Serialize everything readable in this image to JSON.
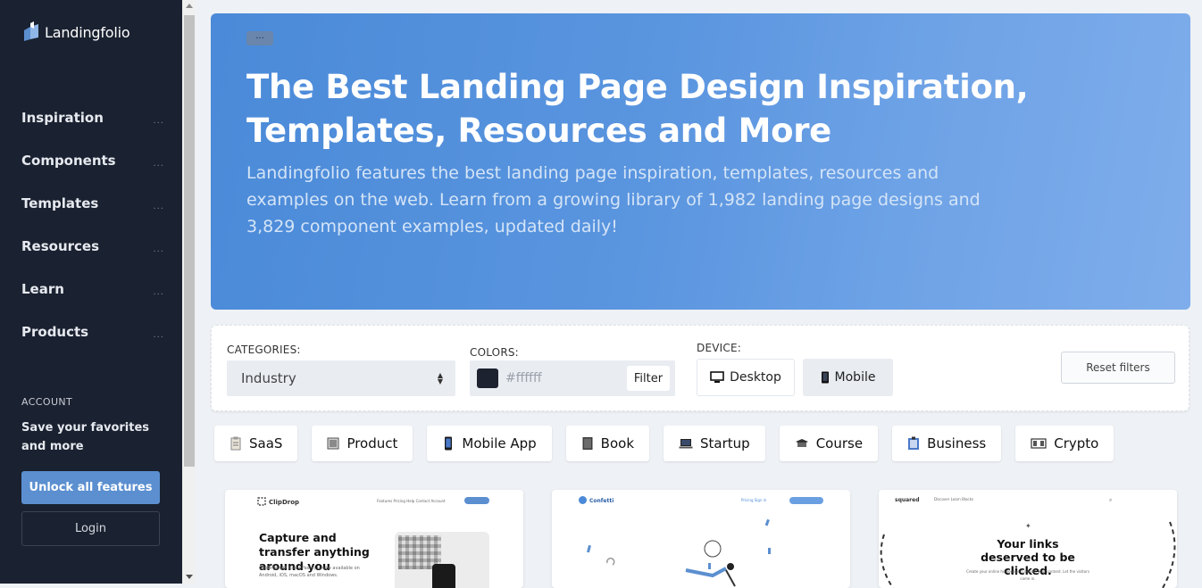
{
  "sidebar": {
    "brand": "Landingfolio",
    "nav": [
      {
        "label": "Inspiration",
        "dots": "..."
      },
      {
        "label": "Components",
        "dots": "..."
      },
      {
        "label": "Templates",
        "dots": "..."
      },
      {
        "label": "Resources",
        "dots": "..."
      },
      {
        "label": "Learn",
        "dots": "..."
      },
      {
        "label": "Products",
        "dots": "..."
      }
    ],
    "account_heading": "ACCOUNT",
    "account_text": "Save your favorites and more",
    "unlock_label": "Unlock all features",
    "login_label": "Login"
  },
  "hero": {
    "pill": "...",
    "title": "The Best Landing Page Design Inspiration, Templates, Resources and More",
    "description": "Landingfolio features the best landing page inspiration, templates, resources and examples on the web. Learn from a growing library of 1,982 landing page designs and 3,829 component examples, updated daily!"
  },
  "filters": {
    "categories_label": "CATEGORIES:",
    "categories_value": "Industry",
    "colors_label": "COLORS:",
    "color_swatch": "#1d2231",
    "color_placeholder": "#ffffff",
    "filter_label": "Filter",
    "device_label": "DEVICE:",
    "desktop_label": "Desktop",
    "mobile_label": "Mobile",
    "reset_label": "Reset filters"
  },
  "chips": [
    {
      "label": "SaaS",
      "icon": "clipboard-icon"
    },
    {
      "label": "Product",
      "icon": "product-icon"
    },
    {
      "label": "Mobile App",
      "icon": "phone-icon"
    },
    {
      "label": "Book",
      "icon": "book-icon"
    },
    {
      "label": "Startup",
      "icon": "laptop-icon"
    },
    {
      "label": "Course",
      "icon": "course-icon"
    },
    {
      "label": "Business",
      "icon": "briefcase-icon"
    },
    {
      "label": "Crypto",
      "icon": "crypto-icon"
    }
  ],
  "cards": {
    "clipdrop": {
      "brand": "ClipDrop",
      "nav": "Features   Pricing   Help   Contact   Account",
      "headline": "Capture and transfer anything around you",
      "sub": "ClipDrop (AR Copy-Paste) is now available on Android, iOS, macOS and Windows."
    },
    "confetti": {
      "brand": "Confetti",
      "nav": "Pricing   Sign in"
    },
    "squared": {
      "brand": "squared",
      "nav": "Discover   Learn   Blocks",
      "headline": "Your links deserved to be clicked.",
      "sub": "Create your online homepage. Connect your content. Let the visitors come in."
    }
  },
  "colors": {
    "sidebar_bg": "#1a2130",
    "hero_start": "#4a8ad8",
    "hero_end": "#7fadeb",
    "accent": "#5b8fd0"
  }
}
